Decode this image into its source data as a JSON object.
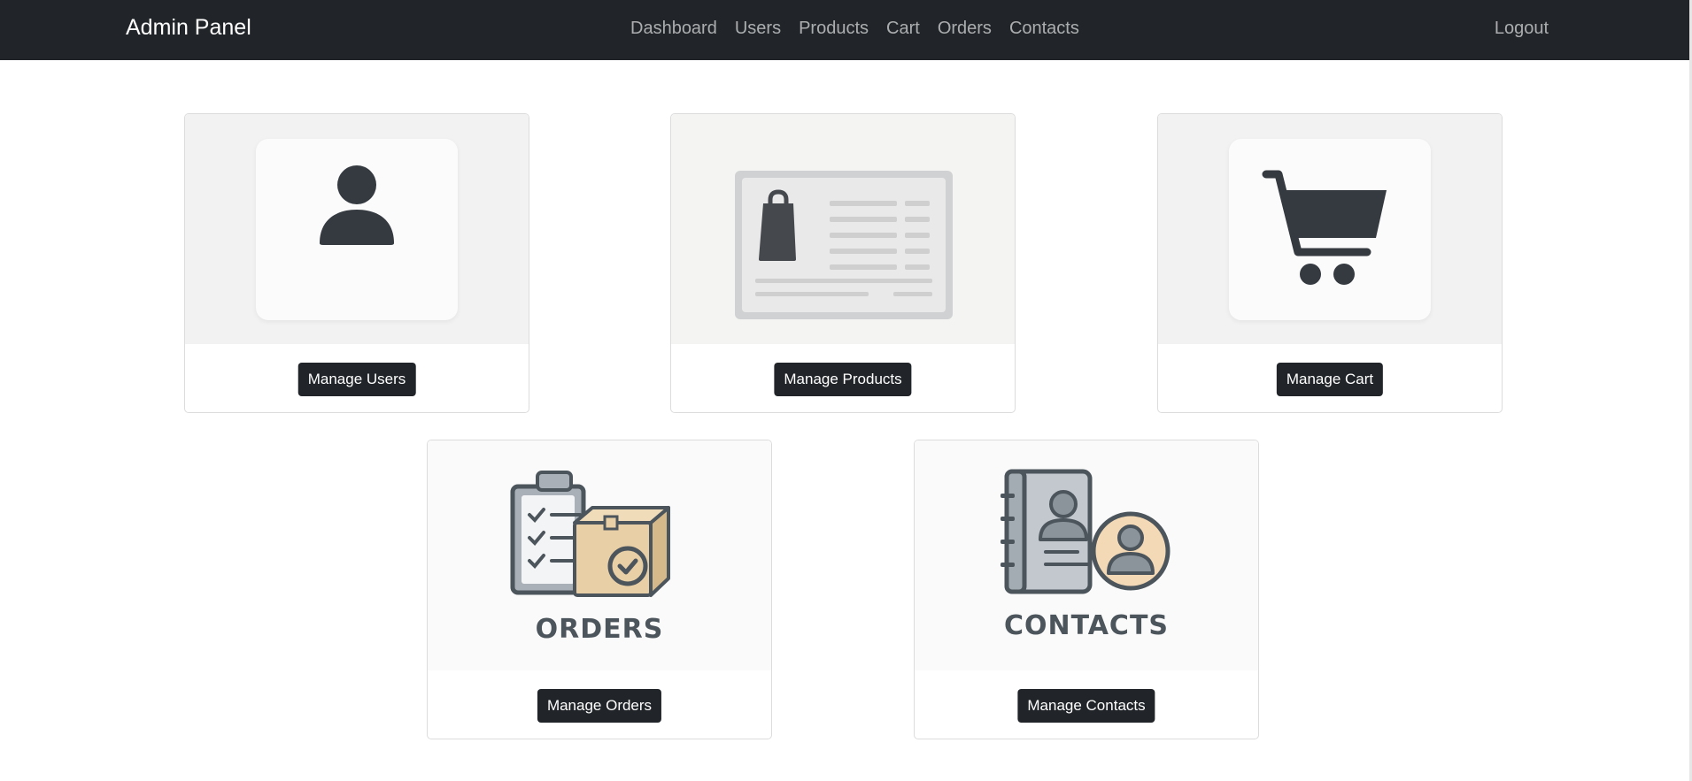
{
  "navbar": {
    "brand": "Admin Panel",
    "links": [
      "Dashboard",
      "Users",
      "Products",
      "Cart",
      "Orders",
      "Contacts"
    ],
    "logout": "Logout"
  },
  "cards": [
    {
      "button": "Manage Users",
      "icon": "user-icon"
    },
    {
      "button": "Manage Products",
      "icon": "product-listing-icon"
    },
    {
      "button": "Manage Cart",
      "icon": "shopping-cart-icon"
    },
    {
      "button": "Manage Orders",
      "icon": "orders-icon",
      "image_text": "ORDERS"
    },
    {
      "button": "Manage Contacts",
      "icon": "contacts-icon",
      "image_text": "CONTACTS"
    }
  ],
  "colors": {
    "navbar_bg": "#212529",
    "button_bg": "#212529",
    "icon_dark": "#343a40",
    "box_tan": "#e9cfa6"
  }
}
